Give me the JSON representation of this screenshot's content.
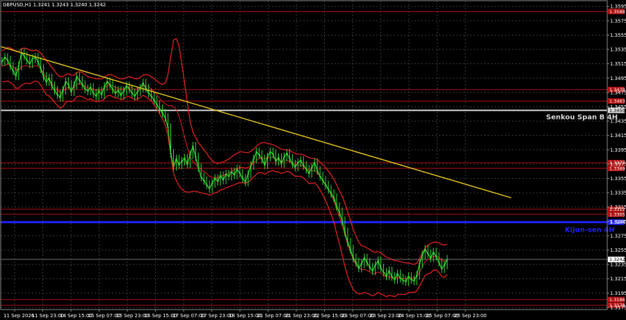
{
  "header": {
    "symbol_text": "GBPUSD,H1  1.3241 1.3243 1.3240 1.3242"
  },
  "chart_data": {
    "type": "line",
    "title": "",
    "xlabel": "",
    "ylabel": "",
    "ylim": [
      1.3172,
      1.3603
    ],
    "grid": true,
    "colors": {
      "background": "#000000",
      "grid": "#3c3c3c",
      "frame": "#8a8a8a",
      "candles": "#33dd33",
      "band": "#e02020",
      "trendline": "#e0c020",
      "senkou": "#d6d6d6",
      "kijun": "#2020ff",
      "level": "#b01010"
    },
    "y_ticks": [
      "1.3595",
      "1.3575",
      "1.3555",
      "1.3535",
      "1.3515",
      "1.3495",
      "1.3475",
      "1.3455",
      "1.3435",
      "1.3415",
      "1.3395",
      "1.3375",
      "1.3355",
      "1.3335",
      "1.3315",
      "1.3295",
      "1.3275",
      "1.3255",
      "1.3235",
      "1.3215",
      "1.3195",
      "1.3175"
    ],
    "x_labels": [
      "11 Sep 2026",
      "11 Sep 23:00",
      "14 Sep 15:00",
      "15 Sep 07:00",
      "15 Sep 23:00",
      "16 Sep 15:00",
      "17 Sep 07:00",
      "17 Sep 23:00",
      "18 Sep 15:00",
      "21 Sep 07:00",
      "21 Sep 23:00",
      "22 Sep 15:00",
      "23 Sep 07:00",
      "23 Sep 23:00",
      "24 Sep 15:00",
      "25 Sep 07:00",
      "25 Sep 23:00"
    ],
    "current_price": "1.3242",
    "levels": [
      {
        "name": "1.3588",
        "price": 1.3588,
        "tag": "1.3588"
      },
      {
        "name": "1.3479",
        "price": 1.3479,
        "tag": "1.3479"
      },
      {
        "name": "1.3463",
        "price": 1.3463,
        "tag": "1.3463"
      },
      {
        "name": "1.3377",
        "price": 1.3377,
        "tag": "1.3377"
      },
      {
        "name": "1.3369",
        "price": 1.3369,
        "tag": "1.3369"
      },
      {
        "name": "1.3312",
        "price": 1.3312,
        "tag": "1.3312"
      },
      {
        "name": "1.3305",
        "price": 1.3305,
        "tag": "1.3305"
      },
      {
        "name": "1.3186",
        "price": 1.3186,
        "tag": "1.3186"
      },
      {
        "name": "1.3178",
        "price": 1.3178,
        "tag": "1.3178"
      }
    ],
    "senkou_span_b": {
      "label": "Senkou Span B 4H",
      "price": 1.345,
      "tag": "1.3450"
    },
    "kijun_sen": {
      "label": "Kijun-sen 4H",
      "price": 1.3294,
      "tag": "1.3294"
    },
    "trendline": {
      "start": [
        0.0,
        1.3539
      ],
      "end": [
        1.0,
        1.3328
      ]
    },
    "series": [
      {
        "values": [
          1.3518,
          1.3524,
          1.352,
          1.3512,
          1.3505,
          1.3498,
          1.3512,
          1.353,
          1.3526,
          1.352,
          1.3515,
          1.3522,
          1.3524,
          1.3518,
          1.3508,
          1.3497,
          1.349,
          1.3495,
          1.3484,
          1.3478,
          1.3472,
          1.3468,
          1.3478,
          1.349,
          1.3486,
          1.3476,
          1.3485,
          1.3497,
          1.3492,
          1.3486,
          1.348,
          1.3477,
          1.3482,
          1.3474,
          1.347,
          1.3477,
          1.3472,
          1.3483,
          1.349,
          1.3486,
          1.3479,
          1.3474,
          1.3478,
          1.3471,
          1.3477,
          1.3484,
          1.348,
          1.3474,
          1.347,
          1.3476,
          1.3481,
          1.3488,
          1.3481,
          1.3474,
          1.347,
          1.3464,
          1.3458,
          1.3452,
          1.3446,
          1.344,
          1.3426,
          1.339,
          1.3372,
          1.3382,
          1.3374,
          1.3379,
          1.3383,
          1.3375,
          1.3388,
          1.34,
          1.3385,
          1.337,
          1.3357,
          1.3352,
          1.3346,
          1.3341,
          1.3348,
          1.3355,
          1.3351,
          1.3359,
          1.3353,
          1.3361,
          1.3358,
          1.3364,
          1.336,
          1.3368,
          1.3362,
          1.3355,
          1.335,
          1.3361,
          1.3373,
          1.3382,
          1.3392,
          1.3388,
          1.3382,
          1.3374,
          1.3385,
          1.3392,
          1.3389,
          1.3379,
          1.3384,
          1.3376,
          1.3385,
          1.339,
          1.3383,
          1.3375,
          1.3371,
          1.3377,
          1.338,
          1.3373,
          1.3368,
          1.3362,
          1.337,
          1.3377,
          1.3366,
          1.3358,
          1.3352,
          1.3346,
          1.334,
          1.3334,
          1.3328,
          1.3316,
          1.3308,
          1.3296,
          1.328,
          1.3266,
          1.3256,
          1.3244,
          1.3238,
          1.323,
          1.3236,
          1.3244,
          1.3238,
          1.3231,
          1.3226,
          1.3234,
          1.324,
          1.323,
          1.3224,
          1.3219,
          1.3226,
          1.3218,
          1.3214,
          1.3222,
          1.3216,
          1.3213,
          1.3211,
          1.3218,
          1.3214,
          1.3212,
          1.322,
          1.3236,
          1.3248,
          1.3256,
          1.325,
          1.3244,
          1.3252,
          1.3246,
          1.3238,
          1.3229,
          1.3234,
          1.3242
        ],
        "band_upper": [
          1.3533,
          1.3535,
          1.3538,
          1.3537,
          1.3535,
          1.3532,
          1.3532,
          1.3536,
          1.3537,
          1.3536,
          1.3534,
          1.3533,
          1.3534,
          1.3533,
          1.353,
          1.3525,
          1.3519,
          1.3515,
          1.351,
          1.3505,
          1.35,
          1.3497,
          1.3497,
          1.35,
          1.3501,
          1.3499,
          1.3499,
          1.3503,
          1.3504,
          1.3503,
          1.35,
          1.3497,
          1.3496,
          1.3495,
          1.3494,
          1.3494,
          1.3494,
          1.3496,
          1.3499,
          1.35,
          1.3499,
          1.3497,
          1.3495,
          1.3494,
          1.3494,
          1.3496,
          1.3497,
          1.3496,
          1.3494,
          1.3494,
          1.3496,
          1.3499,
          1.35,
          1.3499,
          1.3497,
          1.3494,
          1.3491,
          1.3488,
          1.3486,
          1.3488,
          1.35,
          1.3525,
          1.3548,
          1.355,
          1.354,
          1.3515,
          1.3488,
          1.346,
          1.3435,
          1.342,
          1.3412,
          1.3405,
          1.34,
          1.3395,
          1.339,
          1.3384,
          1.338,
          1.3377,
          1.3376,
          1.3377,
          1.3378,
          1.338,
          1.3382,
          1.3385,
          1.3388,
          1.339,
          1.3392,
          1.3392,
          1.3391,
          1.3391,
          1.3393,
          1.3396,
          1.34,
          1.3403,
          1.3405,
          1.3405,
          1.3404,
          1.3403,
          1.3402,
          1.34,
          1.3398,
          1.3396,
          1.3395,
          1.3395,
          1.3394,
          1.3392,
          1.339,
          1.3389,
          1.3389,
          1.3388,
          1.3386,
          1.3384,
          1.3383,
          1.3383,
          1.3381,
          1.3378,
          1.3374,
          1.337,
          1.3365,
          1.336,
          1.3354,
          1.3346,
          1.3338,
          1.333,
          1.332,
          1.3308,
          1.3296,
          1.3284,
          1.3274,
          1.3266,
          1.3261,
          1.326,
          1.3258,
          1.3256,
          1.3253,
          1.3252,
          1.3253,
          1.3251,
          1.3248,
          1.3245,
          1.3244,
          1.3242,
          1.324,
          1.324,
          1.3239,
          1.3238,
          1.3237,
          1.3237,
          1.3236,
          1.3235,
          1.3237,
          1.3243,
          1.3251,
          1.3258,
          1.3262,
          1.3264,
          1.3266,
          1.3266,
          1.3265,
          1.3263,
          1.3262,
          1.3263
        ],
        "band_lower": [
          1.349,
          1.349,
          1.3491,
          1.3489,
          1.3486,
          1.3481,
          1.3481,
          1.3485,
          1.3487,
          1.3488,
          1.3487,
          1.3489,
          1.3491,
          1.349,
          1.3485,
          1.3478,
          1.3472,
          1.347,
          1.3466,
          1.3461,
          1.3457,
          1.3453,
          1.3455,
          1.3461,
          1.3463,
          1.3462,
          1.3464,
          1.3469,
          1.347,
          1.3469,
          1.3467,
          1.3465,
          1.3466,
          1.3464,
          1.3462,
          1.3463,
          1.3463,
          1.3466,
          1.347,
          1.3471,
          1.3469,
          1.3467,
          1.3467,
          1.3465,
          1.3466,
          1.3469,
          1.3469,
          1.3467,
          1.3465,
          1.3466,
          1.3468,
          1.3471,
          1.3469,
          1.3466,
          1.3463,
          1.3458,
          1.3452,
          1.3445,
          1.3438,
          1.343,
          1.3414,
          1.3388,
          1.3362,
          1.3352,
          1.3345,
          1.334,
          1.3337,
          1.3336,
          1.3336,
          1.3337,
          1.3337,
          1.3336,
          1.3335,
          1.3334,
          1.3333,
          1.3332,
          1.3333,
          1.3335,
          1.3336,
          1.3339,
          1.334,
          1.3342,
          1.3343,
          1.3345,
          1.3346,
          1.3348,
          1.3349,
          1.3349,
          1.3348,
          1.335,
          1.3353,
          1.3357,
          1.3361,
          1.3363,
          1.3363,
          1.3361,
          1.3363,
          1.3365,
          1.3366,
          1.3364,
          1.3364,
          1.3362,
          1.3363,
          1.3365,
          1.3364,
          1.3361,
          1.3358,
          1.3358,
          1.3358,
          1.3356,
          1.3352,
          1.3348,
          1.3348,
          1.3349,
          1.3345,
          1.3339,
          1.3332,
          1.3324,
          1.3315,
          1.3305,
          1.3294,
          1.3278,
          1.3264,
          1.3248,
          1.3232,
          1.3218,
          1.3208,
          1.32,
          1.3196,
          1.3194,
          1.3194,
          1.3196,
          1.3195,
          1.3193,
          1.3191,
          1.3193,
          1.3196,
          1.3194,
          1.3192,
          1.319,
          1.3192,
          1.3191,
          1.319,
          1.3193,
          1.3193,
          1.3193,
          1.3193,
          1.3196,
          1.3196,
          1.3196,
          1.3198,
          1.3205,
          1.3212,
          1.322,
          1.3222,
          1.3223,
          1.3227,
          1.3227,
          1.3224,
          1.3218,
          1.3217,
          1.3221
        ]
      }
    ]
  }
}
